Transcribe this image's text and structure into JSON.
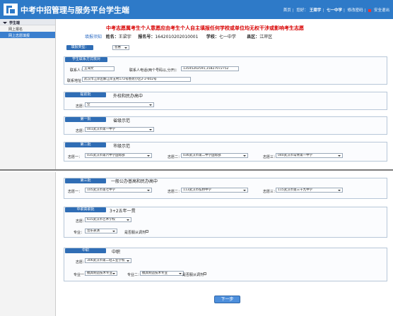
{
  "header": {
    "title": "中考中招管理与服务平台学生端",
    "links": [
      "首页",
      "您好：",
      "王梁宇",
      "七一中学",
      "修改密码",
      "安全退出"
    ],
    "accent": "#2e7ac8"
  },
  "sidebar": {
    "section": "学生端",
    "items": [
      "网上报名",
      "网上志愿填报"
    ],
    "active_index": 1
  },
  "notice": "中考志愿属考生个人意愿应由考生个人自主填报任何学校或单位均无权干涉或影响考生志愿",
  "info": {
    "guide_link": "填报须知",
    "name_label": "姓名：",
    "name": "王梁宇",
    "reg_label": "报名号：",
    "reg": "1642010202010001",
    "school_label": "学校：",
    "school": "七一中学",
    "district_label": "县区：",
    "district": "江岸区"
  },
  "enroll_type": {
    "label": "填报类型：",
    "value": "普惠"
  },
  "contact": {
    "title": "学生联系方式核对",
    "person_label": "联系人：",
    "person": "王海文",
    "phone_label": "联系人电话(两个号码以,分开)：",
    "phone": "13545202591,15827072752",
    "address_label": "联系地址：",
    "address": "武汉市江岸区解江岸五村172号香苑小区2-2-602号"
  },
  "sections": {
    "advance": {
      "title": "提前批",
      "desc": "外校和民办高中",
      "choice_label": "志愿：",
      "choice": "空"
    },
    "first": {
      "title": "第一批",
      "desc": "省级示范",
      "choice_label": "志愿：",
      "choice": "001武汉市第一中学"
    },
    "second": {
      "title": "第二批",
      "desc": "市级示范",
      "choices": [
        {
          "label": "志愿一：",
          "value": "035武汉市第六中学国际部"
        },
        {
          "label": "志愿二：",
          "value": "036武汉市第二中学国际部"
        },
        {
          "label": "志愿三：",
          "value": "040武汉市常青第一中学"
        }
      ]
    },
    "third": {
      "title": "第三批",
      "desc": "一般公办普高和民办高中",
      "choices": [
        {
          "label": "志愿一：",
          "value": "105武汉市第七中学"
        },
        {
          "label": "志愿二：",
          "value": "113武汉市弘桥中学"
        },
        {
          "label": "志愿三：",
          "value": "115武汉市第三十九中学"
        }
      ]
    },
    "vocational_3plus2": {
      "title": "中职高职批",
      "desc": "3+2五年一贯",
      "choice_label": "志愿：",
      "choice": "615武汉市艺术学校",
      "major_label": "专业：",
      "major": "音乐表演",
      "obey_label": "是否服从调剂"
    },
    "vocational": {
      "title": "中职",
      "desc": "中职",
      "choice_label": "志愿：",
      "choice": "306武汉市第二轻工业学校",
      "major1_label": "专业一：",
      "major1": "模具制造技术专业",
      "major2_label": "专业二：",
      "major2": "模具制造技术专业",
      "obey_label": "是否服从调剂"
    }
  },
  "next_button": "下一步"
}
